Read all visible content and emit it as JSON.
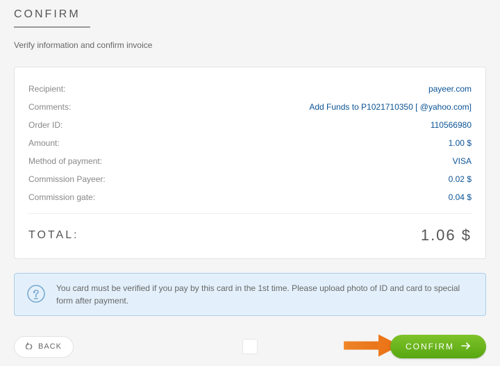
{
  "heading": "CONFIRM",
  "subtitle": "Verify information and confirm invoice",
  "details": {
    "recipient_label": "Recipient:",
    "recipient_value": "payeer.com",
    "comments_label": "Comments:",
    "comments_value": "Add Funds to P1021710350 [         @yahoo.com]",
    "orderid_label": "Order ID:",
    "orderid_value": "110566980",
    "amount_label": "Amount:",
    "amount_value": "1.00 $",
    "method_label": "Method of payment:",
    "method_value": "VISA",
    "comm_payeer_label": "Commission Payeer:",
    "comm_payeer_value": "0.02 $",
    "comm_gate_label": "Commission gate:",
    "comm_gate_value": "0.04 $"
  },
  "total": {
    "label": "TOTAL:",
    "value": "1.06 $"
  },
  "info_message": "You card must be verified if you pay by this card in the 1st time. Please upload photo of ID and card to special form after payment.",
  "buttons": {
    "back": "BACK",
    "confirm": "CONFIRM"
  }
}
